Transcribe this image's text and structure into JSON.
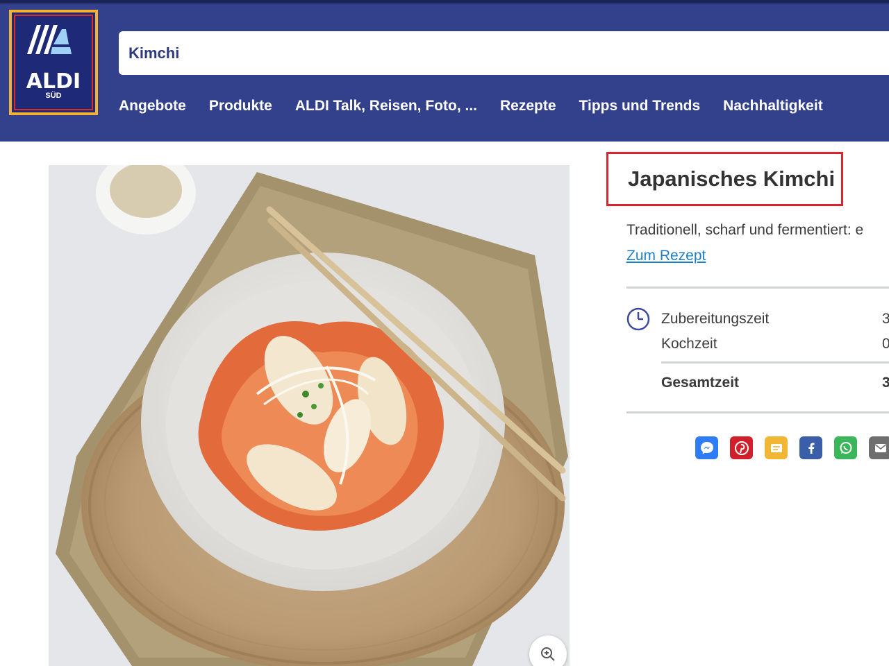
{
  "brand": {
    "name": "ALDI",
    "sub": "SÜD"
  },
  "search": {
    "value": "Kimchi"
  },
  "nav": [
    {
      "label": "Angebote"
    },
    {
      "label": "Produkte"
    },
    {
      "label": "ALDI Talk, Reisen, Foto, ..."
    },
    {
      "label": "Rezepte"
    },
    {
      "label": "Tipps und Trends"
    },
    {
      "label": "Nachhaltigkeit"
    }
  ],
  "recipe": {
    "title": "Japanisches Kimchi",
    "teaser": "Traditionell, scharf und fermentiert: e",
    "link_label": "Zum Rezept",
    "times": [
      {
        "label": "Zubereitungszeit",
        "value": "3"
      },
      {
        "label": "Kochzeit",
        "value": "0"
      },
      {
        "label": "Gesamtzeit",
        "value": "3"
      }
    ]
  },
  "share": [
    {
      "icon": "messenger-icon",
      "color": "#2f7df6"
    },
    {
      "icon": "pinterest-icon",
      "color": "#d0202c"
    },
    {
      "icon": "sms-icon",
      "color": "#f1b634"
    },
    {
      "icon": "facebook-icon",
      "color": "#3a5fa8"
    },
    {
      "icon": "whatsapp-icon",
      "color": "#3cb65a"
    },
    {
      "icon": "email-icon",
      "color": "#6f6f6f"
    }
  ],
  "colors": {
    "header": "#33418d",
    "highlight": "#d9232e",
    "link": "#1f7fc4"
  }
}
